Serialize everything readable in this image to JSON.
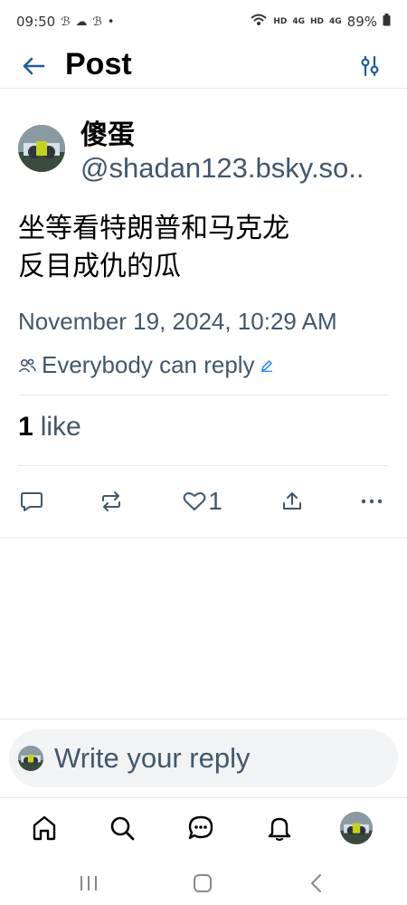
{
  "status_bar": {
    "time": "09:50",
    "left_icons": [
      "app-icon",
      "cloud-icon",
      "app-icon",
      "dot-icon"
    ],
    "right_icons": [
      "wifi-icon",
      "HD",
      "4G",
      "HD",
      "4G",
      "battery-icon"
    ],
    "battery": "89%"
  },
  "header": {
    "title": "Post",
    "back_icon": "arrow-left-icon",
    "filter_icon": "sliders-icon"
  },
  "post": {
    "author": {
      "display_name": "傻蛋",
      "handle": "@shadan123.bsky.so.."
    },
    "text_line1": "坐等看特朗普和马克龙",
    "text_line2": "反目成仇的瓜",
    "timestamp": "November 19, 2024, 10:29 AM",
    "reply_setting": "Everybody can reply",
    "likes": {
      "count": "1",
      "label": "like"
    },
    "actions": {
      "like_count": "1"
    }
  },
  "composer": {
    "placeholder": "Write your reply"
  },
  "bottom_nav": [
    "home-icon",
    "search-icon",
    "chat-icon",
    "bell-icon",
    "avatar"
  ],
  "colors": {
    "muted": "#42576c",
    "accent": "#1083fe",
    "divider": "#e5e8ec",
    "composer_bg": "#f1f3f5"
  }
}
